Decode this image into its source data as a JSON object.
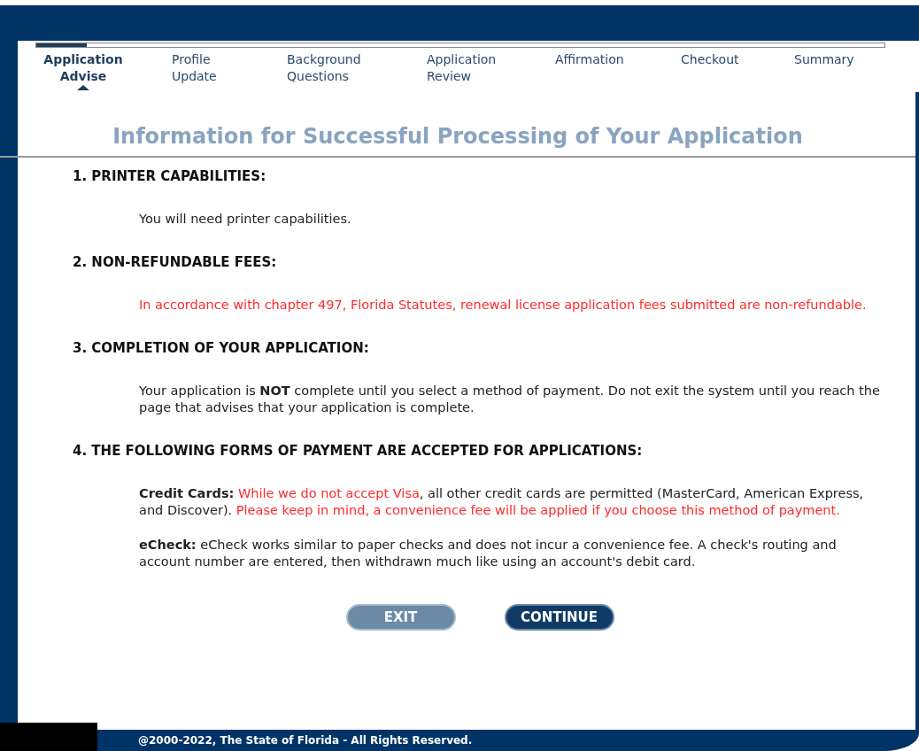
{
  "progress": {
    "level": 0.06
  },
  "steps": [
    {
      "label": "Application Advise",
      "selected": true
    },
    {
      "label": "Profile Update",
      "selected": false
    },
    {
      "label": "Background Questions",
      "selected": false
    },
    {
      "label": "Application Review",
      "selected": false
    },
    {
      "label": "Affirmation",
      "selected": false
    },
    {
      "label": "Checkout",
      "selected": false
    },
    {
      "label": "Summary",
      "selected": false
    }
  ],
  "title": "Information for Successful Processing of Your Application",
  "sections": [
    {
      "heading": "1. PRINTER CAPABILITIES:",
      "paragraphs": [
        [
          {
            "kind": "plain",
            "text": "You will need printer capabilities."
          }
        ]
      ]
    },
    {
      "heading": "2. NON-REFUNDABLE FEES:",
      "paragraphs": [
        [
          {
            "kind": "warning",
            "text": "In accordance with chapter 497, Florida Statutes, renewal license application fees submitted are non-refundable."
          }
        ]
      ]
    },
    {
      "heading": "3. COMPLETION OF YOUR APPLICATION:",
      "paragraphs": [
        [
          {
            "kind": "plain",
            "text": "Your application is "
          },
          {
            "kind": "bold",
            "text": "NOT"
          },
          {
            "kind": "plain",
            "text": " complete until you select a method of payment. Do not exit the system until you reach the page that advises that your application is complete."
          }
        ]
      ]
    },
    {
      "heading": "4. THE FOLLOWING FORMS OF PAYMENT ARE ACCEPTED FOR APPLICATIONS:",
      "paragraphs": [
        [
          {
            "kind": "bold",
            "text": "Credit Cards:"
          },
          {
            "kind": "warning",
            "text": " While we do not accept Visa"
          },
          {
            "kind": "plain",
            "text": ", all other credit cards are permitted (MasterCard, American Express, and Discover). "
          },
          {
            "kind": "warning",
            "text": "Please keep in mind, a convenience fee will be applied if you choose this method of payment."
          }
        ],
        [
          {
            "kind": "bold",
            "text": "eCheck:"
          },
          {
            "kind": "plain",
            "text": " eCheck works similar to paper checks and does not incur a convenience fee. A check's routing and account number are entered, then withdrawn much like using an account's debit card."
          }
        ]
      ]
    }
  ],
  "buttons": [
    {
      "label": "EXIT",
      "kind": "secondary"
    },
    {
      "label": "CONTINUE",
      "kind": "primary"
    }
  ],
  "footer": "@2000-2022, The State of Florida - All Rights Reserved."
}
